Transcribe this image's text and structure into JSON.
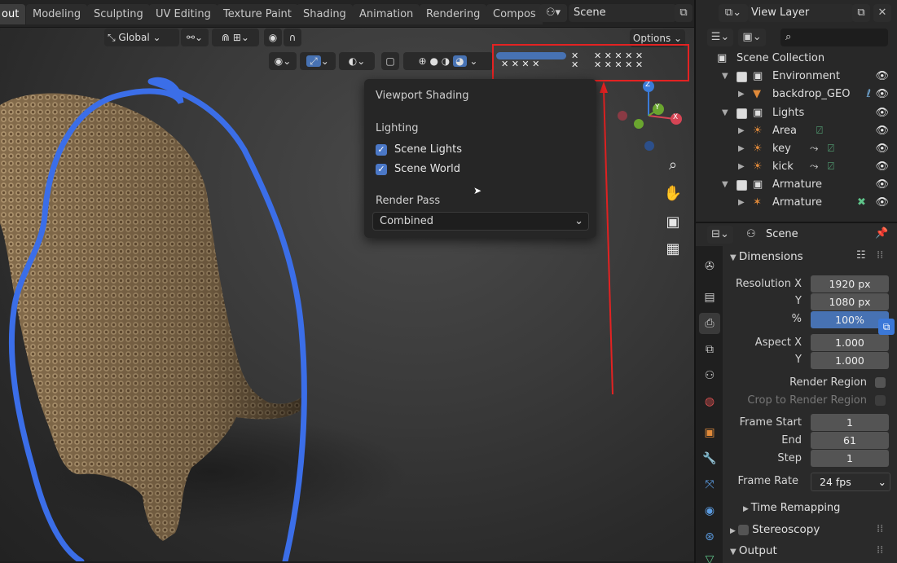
{
  "workspace_tabs": [
    "out",
    "Modeling",
    "Sculpting",
    "UV Editing",
    "Texture Paint",
    "Shading",
    "Animation",
    "Rendering",
    "Compos"
  ],
  "scene_selector": {
    "value": "Scene"
  },
  "view_layer_selector": {
    "value": "View Layer"
  },
  "viewport_header": {
    "transform_orientation": "Global",
    "options_label": "Options"
  },
  "shading_popover": {
    "title": "Viewport Shading",
    "lighting_label": "Lighting",
    "scene_lights_label": "Scene Lights",
    "scene_lights_checked": true,
    "scene_world_label": "Scene World",
    "scene_world_checked": true,
    "render_pass_label": "Render Pass",
    "render_pass_value": "Combined"
  },
  "gizmo": {
    "z_label": "Z",
    "y_label": "Y",
    "x_label": "X"
  },
  "outliner": {
    "search_placeholder": "",
    "rows": [
      {
        "label": "Scene Collection"
      },
      {
        "label": "Environment"
      },
      {
        "label": "backdrop_GEO"
      },
      {
        "label": "Lights"
      },
      {
        "label": "Area"
      },
      {
        "label": "key"
      },
      {
        "label": "kick"
      },
      {
        "label": "Armature"
      },
      {
        "label": "Armature"
      }
    ]
  },
  "properties": {
    "context_title": "Scene",
    "dimensions": {
      "header": "Dimensions",
      "resolution_x_label": "Resolution X",
      "resolution_x": "1920 px",
      "resolution_y_label": "Y",
      "resolution_y": "1080 px",
      "percent_label": "%",
      "percent": "100%",
      "aspect_x_label": "Aspect X",
      "aspect_x": "1.000",
      "aspect_y_label": "Y",
      "aspect_y": "1.000",
      "render_region_label": "Render Region",
      "crop_label": "Crop to Render Region",
      "frame_start_label": "Frame Start",
      "frame_start": "1",
      "frame_end_label": "End",
      "frame_end": "61",
      "frame_step_label": "Step",
      "frame_step": "1",
      "frame_rate_label": "Frame Rate",
      "frame_rate": "24 fps",
      "time_remapping_label": "Time Remapping"
    },
    "stereoscopy_label": "Stereoscopy",
    "output_label": "Output"
  },
  "colors": {
    "accent_blue": "#4772b3",
    "annotation_red": "#e32222",
    "annotation_blue": "#3b6ee8"
  }
}
